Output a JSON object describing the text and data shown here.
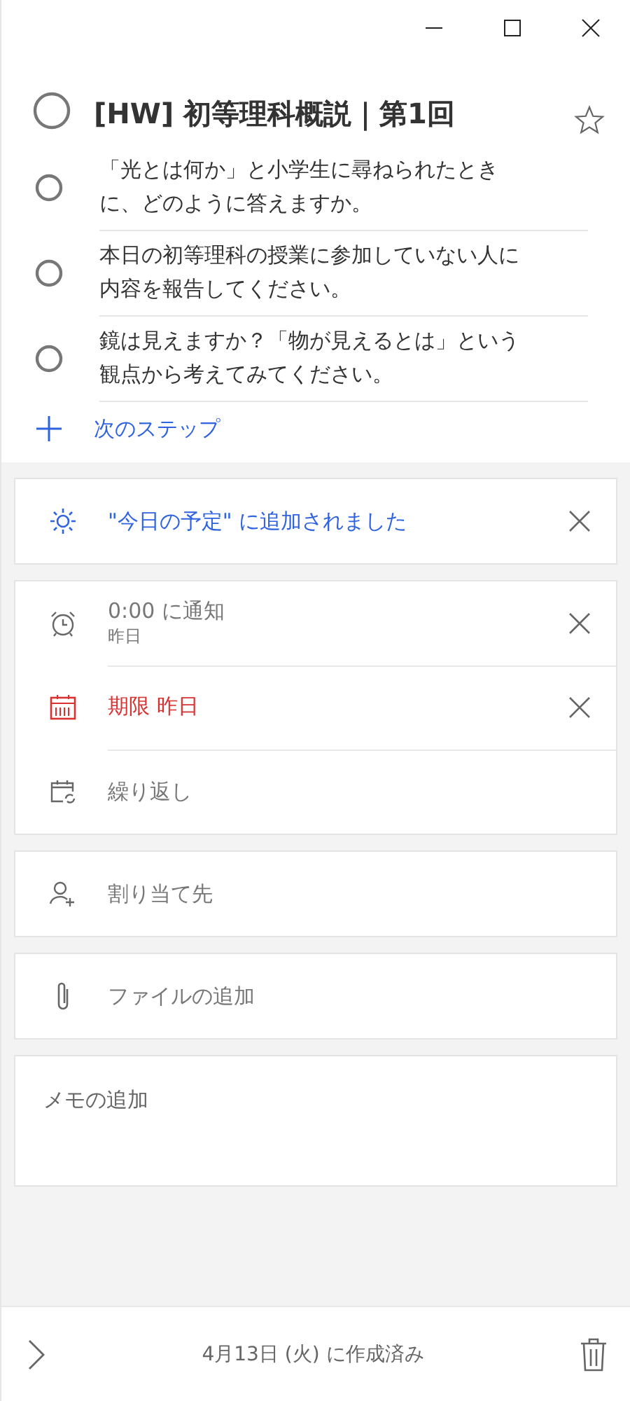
{
  "task": {
    "title": "[HW] 初等理科概説｜第1回",
    "completed": false,
    "starred": false
  },
  "steps": [
    {
      "text": "「光とは何か」と小学生に尋ねられたときに、どのように答えますか。",
      "completed": false
    },
    {
      "text": "本日の初等理科の授業に参加していない人に内容を報告してください。",
      "completed": false
    },
    {
      "text": "鏡は見えますか？「物が見えるとは」という観点から考えてみてください。",
      "completed": false
    }
  ],
  "add_step": {
    "label": "次のステップ"
  },
  "my_day": {
    "label": "\"今日の予定\" に追加されました",
    "added": true
  },
  "schedule": [
    {
      "kind": "reminder",
      "label": "0:00 に通知",
      "sublabel": "昨日",
      "set": true
    },
    {
      "kind": "due",
      "label": "期限 昨日",
      "set": true,
      "overdue": true
    },
    {
      "kind": "repeat",
      "label": "繰り返し",
      "set": false
    }
  ],
  "assign": {
    "label": "割り当て先"
  },
  "file": {
    "label": "ファイルの追加"
  },
  "note": {
    "placeholder": "メモの追加"
  },
  "footer": {
    "created": "4月13日 (火) に作成済み"
  }
}
